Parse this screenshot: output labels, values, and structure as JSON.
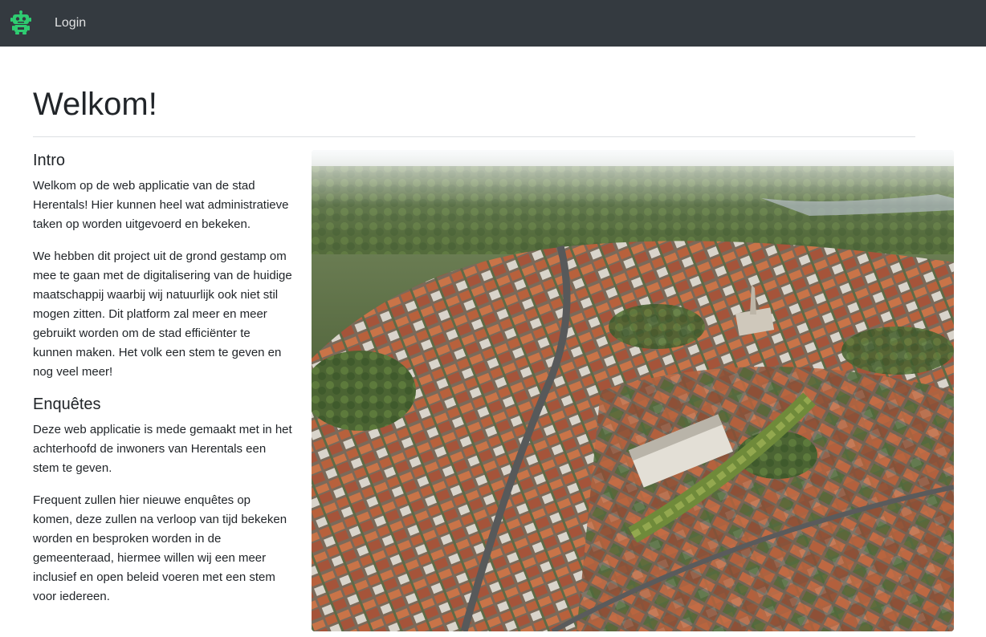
{
  "navbar": {
    "brand_icon": "robot-icon",
    "brand_color": "#2ecc71",
    "login_label": "Login"
  },
  "page": {
    "title": "Welkom!"
  },
  "intro": {
    "heading": "Intro",
    "paragraph1": "Welkom op de web applicatie van de stad Herentals! Hier kunnen heel wat administratieve taken op worden uitgevoerd en bekeken.",
    "paragraph2": "We hebben dit project uit de grond gestamp om mee te gaan met de digitalisering van de huidige maatschappij waarbij wij natuurlijk ook niet stil mogen zitten. Dit platform zal meer en meer gebruikt worden om de stad efficiënter te kunnen maken. Het volk een stem te geven en nog veel meer!"
  },
  "enquetes": {
    "heading": "Enquêtes",
    "paragraph1": "Deze web applicatie is mede gemaakt met in het achterhoofd de inwoners van Herentals een stem te geven.",
    "paragraph2": "Frequent zullen hier nieuwe enquêtes op komen, deze zullen na verloop van tijd bekeken worden en besproken worden in de gemeenteraad, hiermee willen wij een meer inclusief en open beleid voeren met een stem voor iedereen."
  },
  "hero_image": {
    "subject": "aerial-city-photo"
  }
}
